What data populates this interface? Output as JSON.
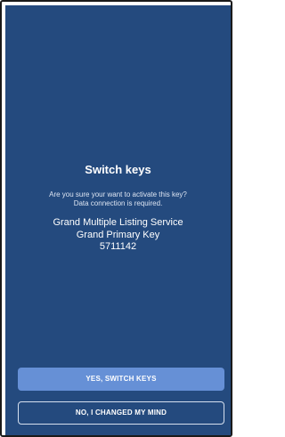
{
  "dialog": {
    "title": "Switch keys",
    "message_line1": "Are you sure your want to activate this key?",
    "message_line2": "Data connection is required.",
    "service_name": "Grand Multiple Listing Service",
    "key_name": "Grand Primary Key",
    "key_number": "5711142"
  },
  "actions": {
    "confirm_label": "YES, SWITCH KEYS",
    "cancel_label": "NO, I CHANGED MY MIND"
  },
  "colors": {
    "background": "#244a7e",
    "primary_button": "#6690d6",
    "text": "#ffffff"
  }
}
